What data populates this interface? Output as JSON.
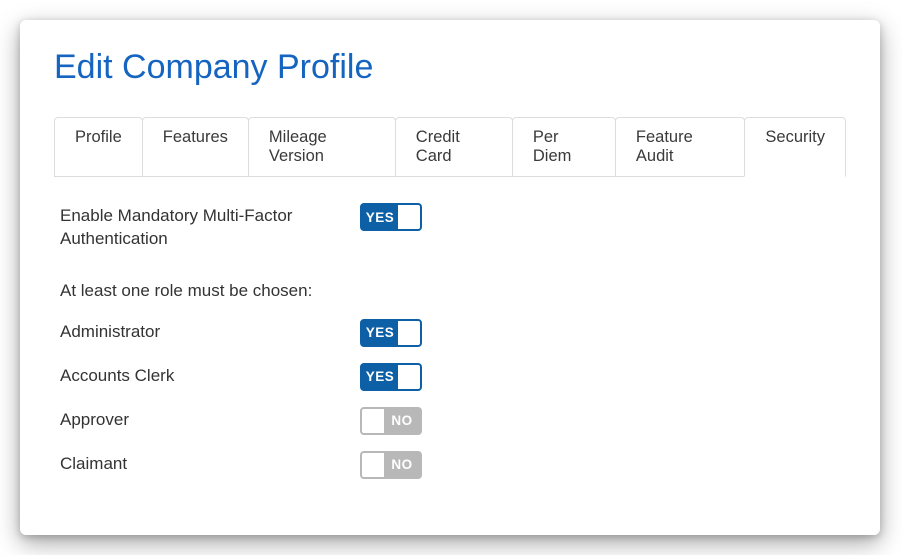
{
  "title": "Edit Company Profile",
  "tabs": [
    {
      "label": "Profile",
      "active": false
    },
    {
      "label": "Features",
      "active": false
    },
    {
      "label": "Mileage Version",
      "active": false
    },
    {
      "label": "Credit Card",
      "active": false
    },
    {
      "label": "Per Diem",
      "active": false
    },
    {
      "label": "Feature Audit",
      "active": false
    },
    {
      "label": "Security",
      "active": true
    }
  ],
  "toggle_labels": {
    "on": "YES",
    "off": "NO"
  },
  "mfa": {
    "label": "Enable Mandatory Multi-Factor Authentication",
    "value": true
  },
  "roles_note": "At least one role must be chosen:",
  "roles": [
    {
      "key": "administrator",
      "label": "Administrator",
      "value": true
    },
    {
      "key": "accounts-clerk",
      "label": "Accounts Clerk",
      "value": true
    },
    {
      "key": "approver",
      "label": "Approver",
      "value": false
    },
    {
      "key": "claimant",
      "label": "Claimant",
      "value": false
    }
  ],
  "colors": {
    "brand": "#0d5fa6",
    "title": "#1565c0",
    "off": "#b8b8b8"
  }
}
